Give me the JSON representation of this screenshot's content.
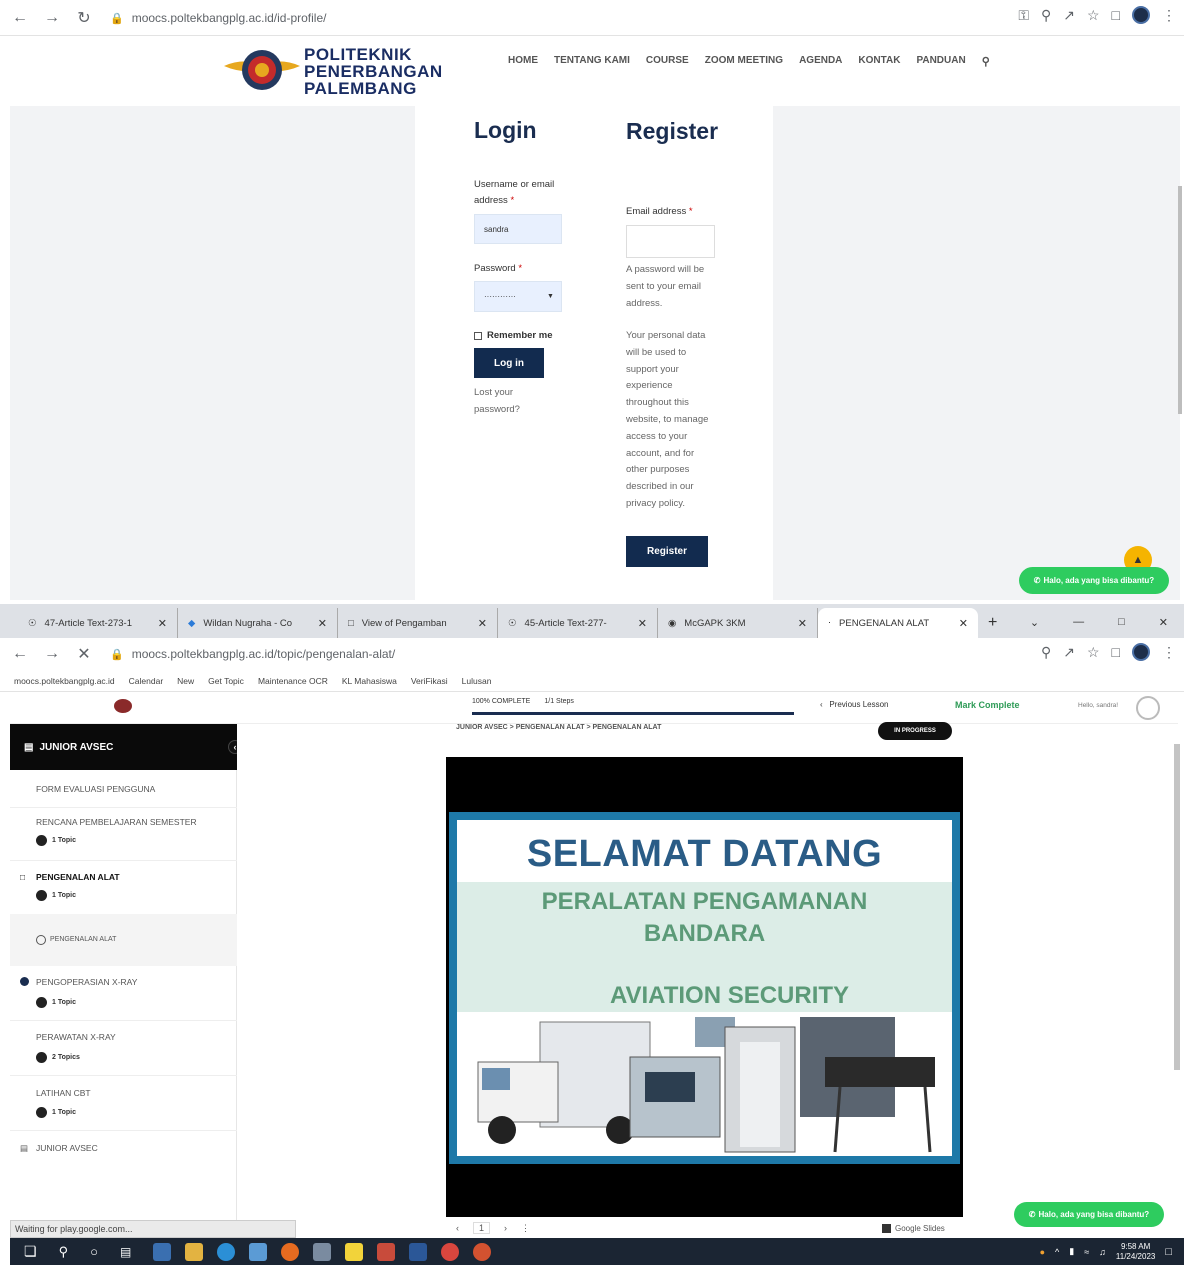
{
  "top": {
    "address_url": "moocs.poltekbangplg.ac.id/id-profile/",
    "logo_lines": [
      "POLITEKNIK",
      "PENERBANGAN",
      "PALEMBANG"
    ],
    "nav": [
      "HOME",
      "TENTANG KAMI",
      "COURSE",
      "ZOOM MEETING",
      "AGENDA",
      "KONTAK",
      "PANDUAN"
    ],
    "login": {
      "title": "Login",
      "username_label": "Username or email address",
      "username_value": "sandra",
      "password_label": "Password",
      "password_value": "············",
      "remember_label": "Remember me",
      "login_button": "Log in",
      "lost_password": "Lost your password?"
    },
    "register": {
      "title": "Register",
      "email_label": "Email address",
      "note1": "A password will be sent to your email address.",
      "note2": "Your personal data will be used to support your experience throughout this website, to manage access to your account, and for other purposes described in our privacy policy.",
      "register_button": "Register"
    },
    "whatsapp_label": "Halo, ada yang bisa dibantu?",
    "required_mark": "*"
  },
  "bottom": {
    "tabs": [
      {
        "label": "47-Article Text-273-1"
      },
      {
        "label": "Wildan Nugraha - Co"
      },
      {
        "label": "View of Pengamban"
      },
      {
        "label": "45-Article Text-277-"
      },
      {
        "label": "McGAPK 3KM"
      },
      {
        "label": "PENGENALAN ALAT"
      }
    ],
    "address_url": "moocs.poltekbangplg.ac.id/topic/pengenalan-alat/",
    "bookmarks": [
      "moocs.poltekbangplg.ac.id",
      "Calendar",
      "New",
      "Get Topic",
      "Maintenance OCR",
      "KL Mahasiswa",
      "VeriFikasi",
      "Lulusan"
    ],
    "header": {
      "progress_label": "100% COMPLETE",
      "steps_label": "1/1 Steps",
      "prev_lesson": "Previous Lesson",
      "mark_complete": "Mark Complete",
      "user_label": "Hello, sandra!",
      "breadcrumb": "JUNIOR AVSEC > PENGENALAN ALAT > PENGENALAN ALAT",
      "badge": "IN PROGRESS"
    },
    "sidebar": {
      "course_title": "JUNIOR AVSEC",
      "items": [
        {
          "title": "FORM EVALUASI PENGGUNA",
          "topics": ""
        },
        {
          "title": "RENCANA PEMBELAJARAN SEMESTER",
          "topics": "1 Topic"
        },
        {
          "title": "PENGENALAN ALAT",
          "topics": "1 Topic"
        },
        {
          "title": "PENGENALAN ALAT",
          "topics": ""
        },
        {
          "title": "PENGOPERASIAN X-RAY",
          "topics": "1 Topic"
        },
        {
          "title": "PERAWATAN X-RAY",
          "topics": "2 Topics"
        },
        {
          "title": "LATIHAN CBT",
          "topics": "1 Topic"
        },
        {
          "title": "JUNIOR AVSEC",
          "topics": ""
        }
      ]
    },
    "slide": {
      "title": "SELAMAT DATANG",
      "subtitle1": "PERALATAN PENGAMANAN",
      "subtitle2": "BANDARA",
      "subtitle3": "AVIATION SECURITY",
      "page": "1",
      "app": "Google Slides"
    },
    "status_text": "Waiting for play.google.com...",
    "whatsapp_label": "Halo, ada yang bisa dibantu?",
    "clock_time": "9:58 AM",
    "clock_date": "11/24/2023"
  }
}
